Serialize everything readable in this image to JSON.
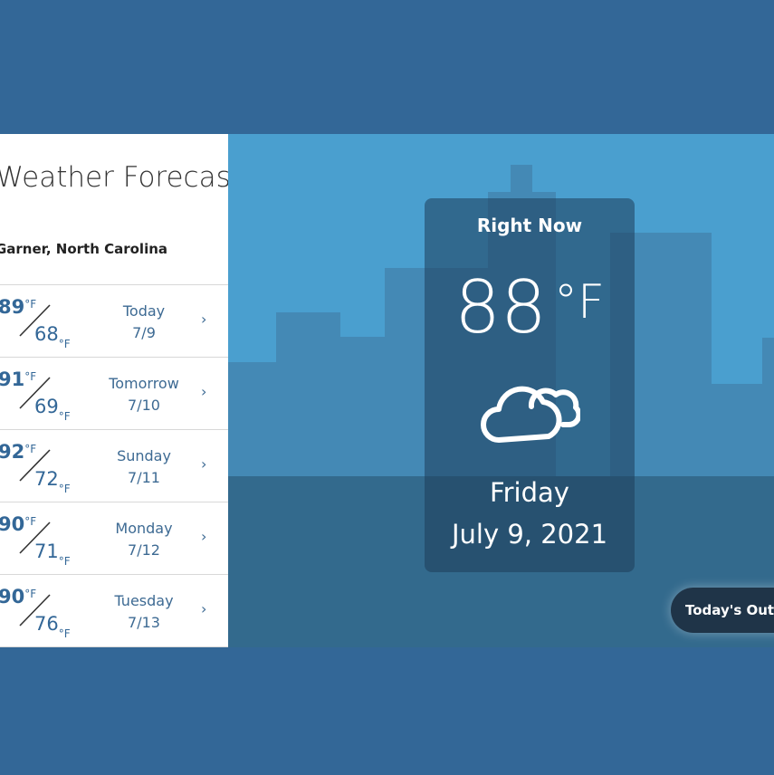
{
  "forecast": {
    "title": "-Day Weather Forecast",
    "location": "Garner, North Carolina",
    "days": [
      {
        "hi": "89",
        "lo": "68",
        "name": "Today",
        "date": "7/9"
      },
      {
        "hi": "91",
        "lo": "69",
        "name": "Tomorrow",
        "date": "7/10"
      },
      {
        "hi": "92",
        "lo": "72",
        "name": "Sunday",
        "date": "7/11"
      },
      {
        "hi": "90",
        "lo": "71",
        "name": "Monday",
        "date": "7/12"
      },
      {
        "hi": "90",
        "lo": "76",
        "name": "Tuesday",
        "date": "7/13"
      }
    ],
    "deg_unit": "°F",
    "chevron": "›"
  },
  "current": {
    "label": "Right Now",
    "temp": "88",
    "unit": "°F",
    "condition_icon": "cloudy-icon",
    "day": "Friday",
    "date": "July 9, 2021"
  },
  "outlook_button": "Today's Outlook",
  "colors": {
    "page_bg": "#336797",
    "sky": "#4a9fcf",
    "accent_text": "#336797"
  }
}
